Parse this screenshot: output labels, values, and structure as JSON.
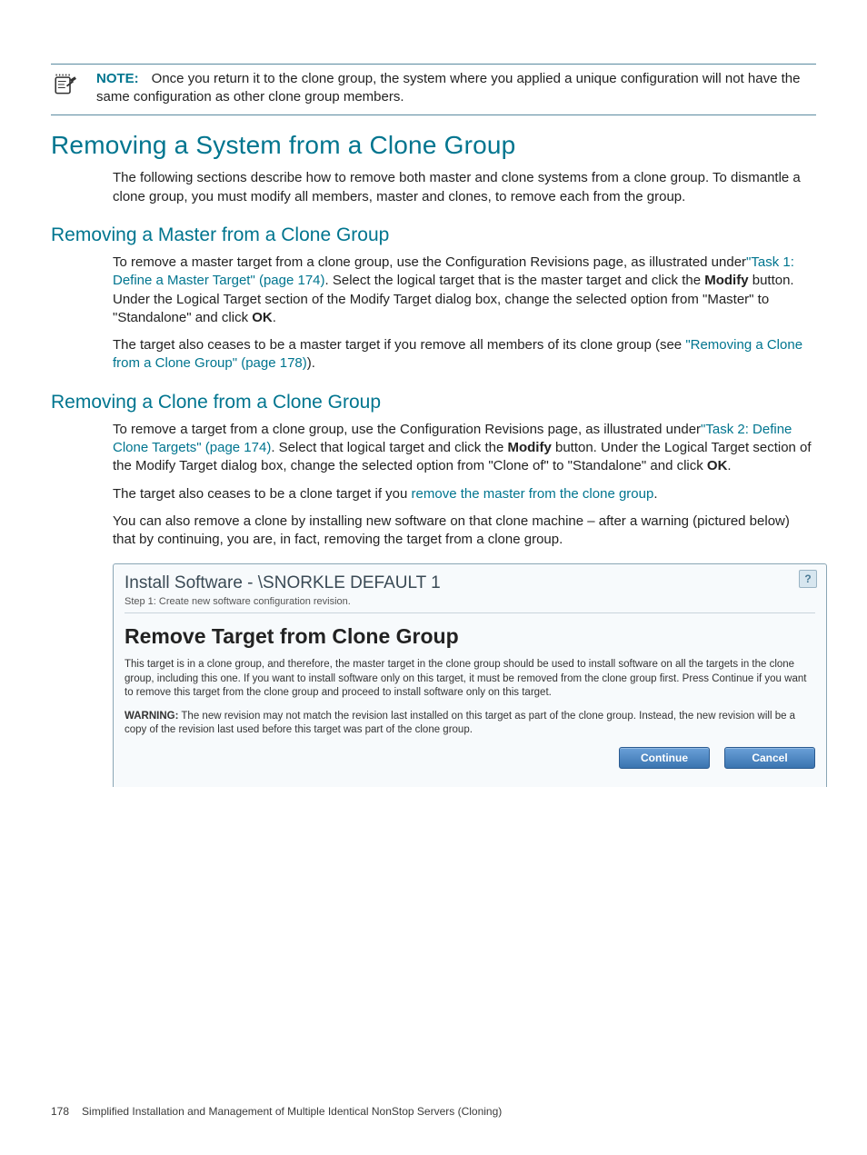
{
  "note": {
    "label": "NOTE:",
    "text": "Once you return it to the clone group, the system where you applied a unique configuration will not have the same configuration as other clone group members."
  },
  "section1": {
    "heading": "Removing a System from a Clone Group",
    "para": "The following sections describe how to remove both master and clone systems from a clone group. To dismantle a clone group, you must modify all members, master and clones, to remove each from the group."
  },
  "section2": {
    "heading": "Removing a Master from a Clone Group",
    "p1a": "To remove a master target from a clone group, use the Configuration Revisions page, as illustrated under",
    "p1_link": "\"Task 1: Define a Master Target\" (page 174)",
    "p1b": ". Select the logical target that is the master target and click the ",
    "p1_bold1": "Modify",
    "p1c": " button. Under the Logical Target section of the Modify Target dialog box, change the selected option from \"Master\" to \"Standalone\" and click ",
    "p1_bold2": "OK",
    "p1d": ".",
    "p2a": "The target also ceases to be a master target if you remove all members of its clone group (see ",
    "p2_link": "\"Removing a Clone from a Clone Group\" (page 178)",
    "p2b": ")."
  },
  "section3": {
    "heading": "Removing a Clone from a Clone Group",
    "p1a": "To remove a target from a clone group, use the Configuration Revisions page, as illustrated under",
    "p1_link": "\"Task 2: Define Clone Targets\" (page 174)",
    "p1b": ". Select that logical target and click the ",
    "p1_bold1": "Modify",
    "p1c": " button. Under the Logical Target section of the Modify Target dialog box, change the selected option from \"Clone of\" to \"Standalone\" and click ",
    "p1_bold2": "OK",
    "p1d": ".",
    "p2a": "The target also ceases to be a clone target if you ",
    "p2_link": "remove the master from the clone group",
    "p2b": ".",
    "p3": "You can also remove a clone by installing new software on that clone machine – after a warning (pictured below) that by continuing, you are, in fact, removing the target from a clone group."
  },
  "panel": {
    "title": "Install Software - \\SNORKLE DEFAULT 1",
    "step": "Step 1: Create new software configuration revision.",
    "help": "?",
    "heading": "Remove Target from Clone Group",
    "body": "This target is in a clone group, and therefore, the master target in the clone group should be used to install software on all the targets in the clone group, including this one. If you want to install software only on this target, it must be removed from the clone group first. Press Continue if you want to remove this target from the clone group and proceed to install software only on this target.",
    "warn_label": "WARNING:",
    "warn_text": " The new revision may not match the revision last installed on this target as part of the clone group. Instead, the new revision will be a copy of the revision last used before this target was part of the clone group.",
    "continue": "Continue",
    "cancel": "Cancel"
  },
  "footer": {
    "page": "178",
    "title": "Simplified Installation and Management of Multiple Identical NonStop Servers (Cloning)"
  }
}
